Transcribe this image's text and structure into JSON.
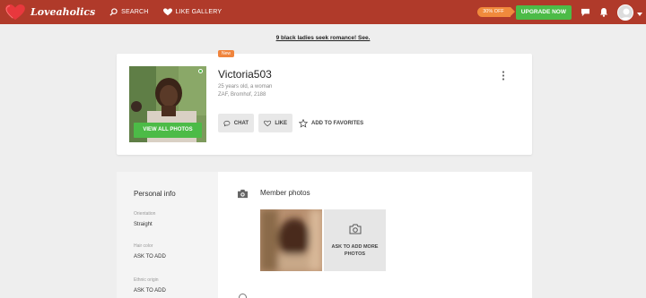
{
  "nav": {
    "logo_text": "Loveaholics",
    "search_label": "SEARCH",
    "like_gallery_label": "LIKE GALLERY",
    "discount_label": "30% OFF",
    "upgrade_label": "UPGRADE NOW"
  },
  "promo": {
    "text": "9 black ladies seek romance! See."
  },
  "profile": {
    "badge": "New",
    "username": "Victoria503",
    "age_line": "25 years old, a woman",
    "location_line": "ZAF, Bromhof, 2188",
    "view_photos_label": "VIEW ALL PHOTOS",
    "chat_label": "CHAT",
    "like_label": "LIKE",
    "favorites_label": "ADD TO FAVORITES"
  },
  "personal": {
    "title": "Personal info",
    "fields": [
      {
        "label": "Orientation",
        "value": "Straight"
      },
      {
        "label": "Hair color",
        "value": "ASK TO ADD"
      },
      {
        "label": "Ethnic origin",
        "value": "ASK TO ADD"
      }
    ]
  },
  "photos": {
    "title": "Member photos",
    "ask_label": "ASK TO ADD MORE PHOTOS"
  },
  "colors": {
    "header": "#b03a2a",
    "accent_green": "#4cbb47",
    "accent_orange": "#f08a3c"
  }
}
